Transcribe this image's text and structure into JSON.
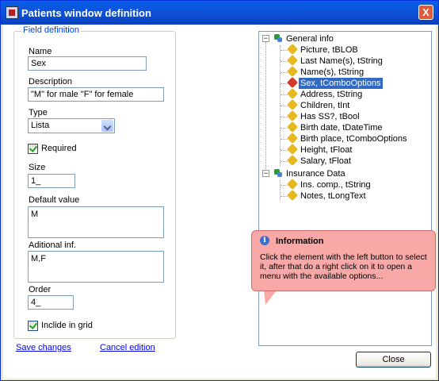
{
  "window": {
    "title": "Patients window definition",
    "close_glyph": "X"
  },
  "field_definition": {
    "legend": "Field definition",
    "name_label": "Name",
    "name_value": "Sex",
    "description_label": "Description",
    "description_value": "\"M\" for male \"F\" for female",
    "type_label": "Type",
    "type_value": "Lista",
    "required_label": "Required",
    "required_checked": true,
    "size_label": "Size",
    "size_value": "1_",
    "default_label": "Default value",
    "default_value": "M",
    "additional_label": "Aditional inf.",
    "additional_value": "M,F",
    "order_label": "Order",
    "order_value": "4_",
    "include_grid_label": "Inclide in grid",
    "include_grid_checked": true
  },
  "links": {
    "save": "Save changes",
    "cancel": "Cancel edition"
  },
  "tree": {
    "groups": [
      {
        "label": "General info",
        "expander": "−",
        "children": [
          {
            "label": "Picture, tBLOB"
          },
          {
            "label": "Last Name(s), tString"
          },
          {
            "label": "Name(s), tString"
          },
          {
            "label": "Sex, tComboOptions",
            "selected": true
          },
          {
            "label": "Address, tString"
          },
          {
            "label": "Children, tInt"
          },
          {
            "label": "Has SS?, tBool"
          },
          {
            "label": "Birth date, tDateTime"
          },
          {
            "label": "Birth place, tComboOptions"
          },
          {
            "label": "Height, tFloat"
          },
          {
            "label": "Salary, tFloat"
          }
        ]
      },
      {
        "label": "Insurance Data",
        "expander": "−",
        "children": [
          {
            "label": "Ins. comp., tString"
          },
          {
            "label": "Notes, tLongText"
          }
        ]
      }
    ]
  },
  "balloon": {
    "icon": "info-icon",
    "icon_glyph": "i",
    "title": "Information",
    "text": "Click the element with the left button to select it, after that do a right click on it to open a menu with the available options..."
  },
  "buttons": {
    "close": "Close"
  },
  "colors": {
    "titlebar": "#0c4fd6",
    "selection": "#316ac5",
    "balloon": "#f8a9a7",
    "link": "#0000ee"
  }
}
